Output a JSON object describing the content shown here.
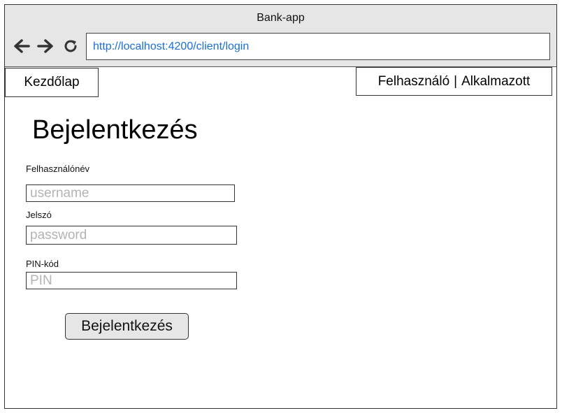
{
  "window": {
    "title": "Bank-app"
  },
  "browser": {
    "url": "http://localhost:4200/client/login",
    "icons": [
      "arrow-left-icon",
      "arrow-right-icon",
      "reload-icon"
    ]
  },
  "nav": {
    "home_label": "Kezdőlap",
    "role_user": "Felhasználó",
    "role_separator": "|",
    "role_employee": "Alkalmazott"
  },
  "login": {
    "title": "Bejelentkezés",
    "username_label": "Felhasználónév",
    "username_placeholder": "username",
    "password_label": "Jelszó",
    "password_placeholder": "password",
    "pin_label": "PIN-kód",
    "pin_placeholder": "PIN",
    "submit_label": "Bejelentkezés"
  },
  "colors": {
    "chrome_bg": "#e6e6e6",
    "url_text": "#1a6fd6",
    "placeholder": "#b3b3b3",
    "button_bg": "#e6e6e6"
  }
}
